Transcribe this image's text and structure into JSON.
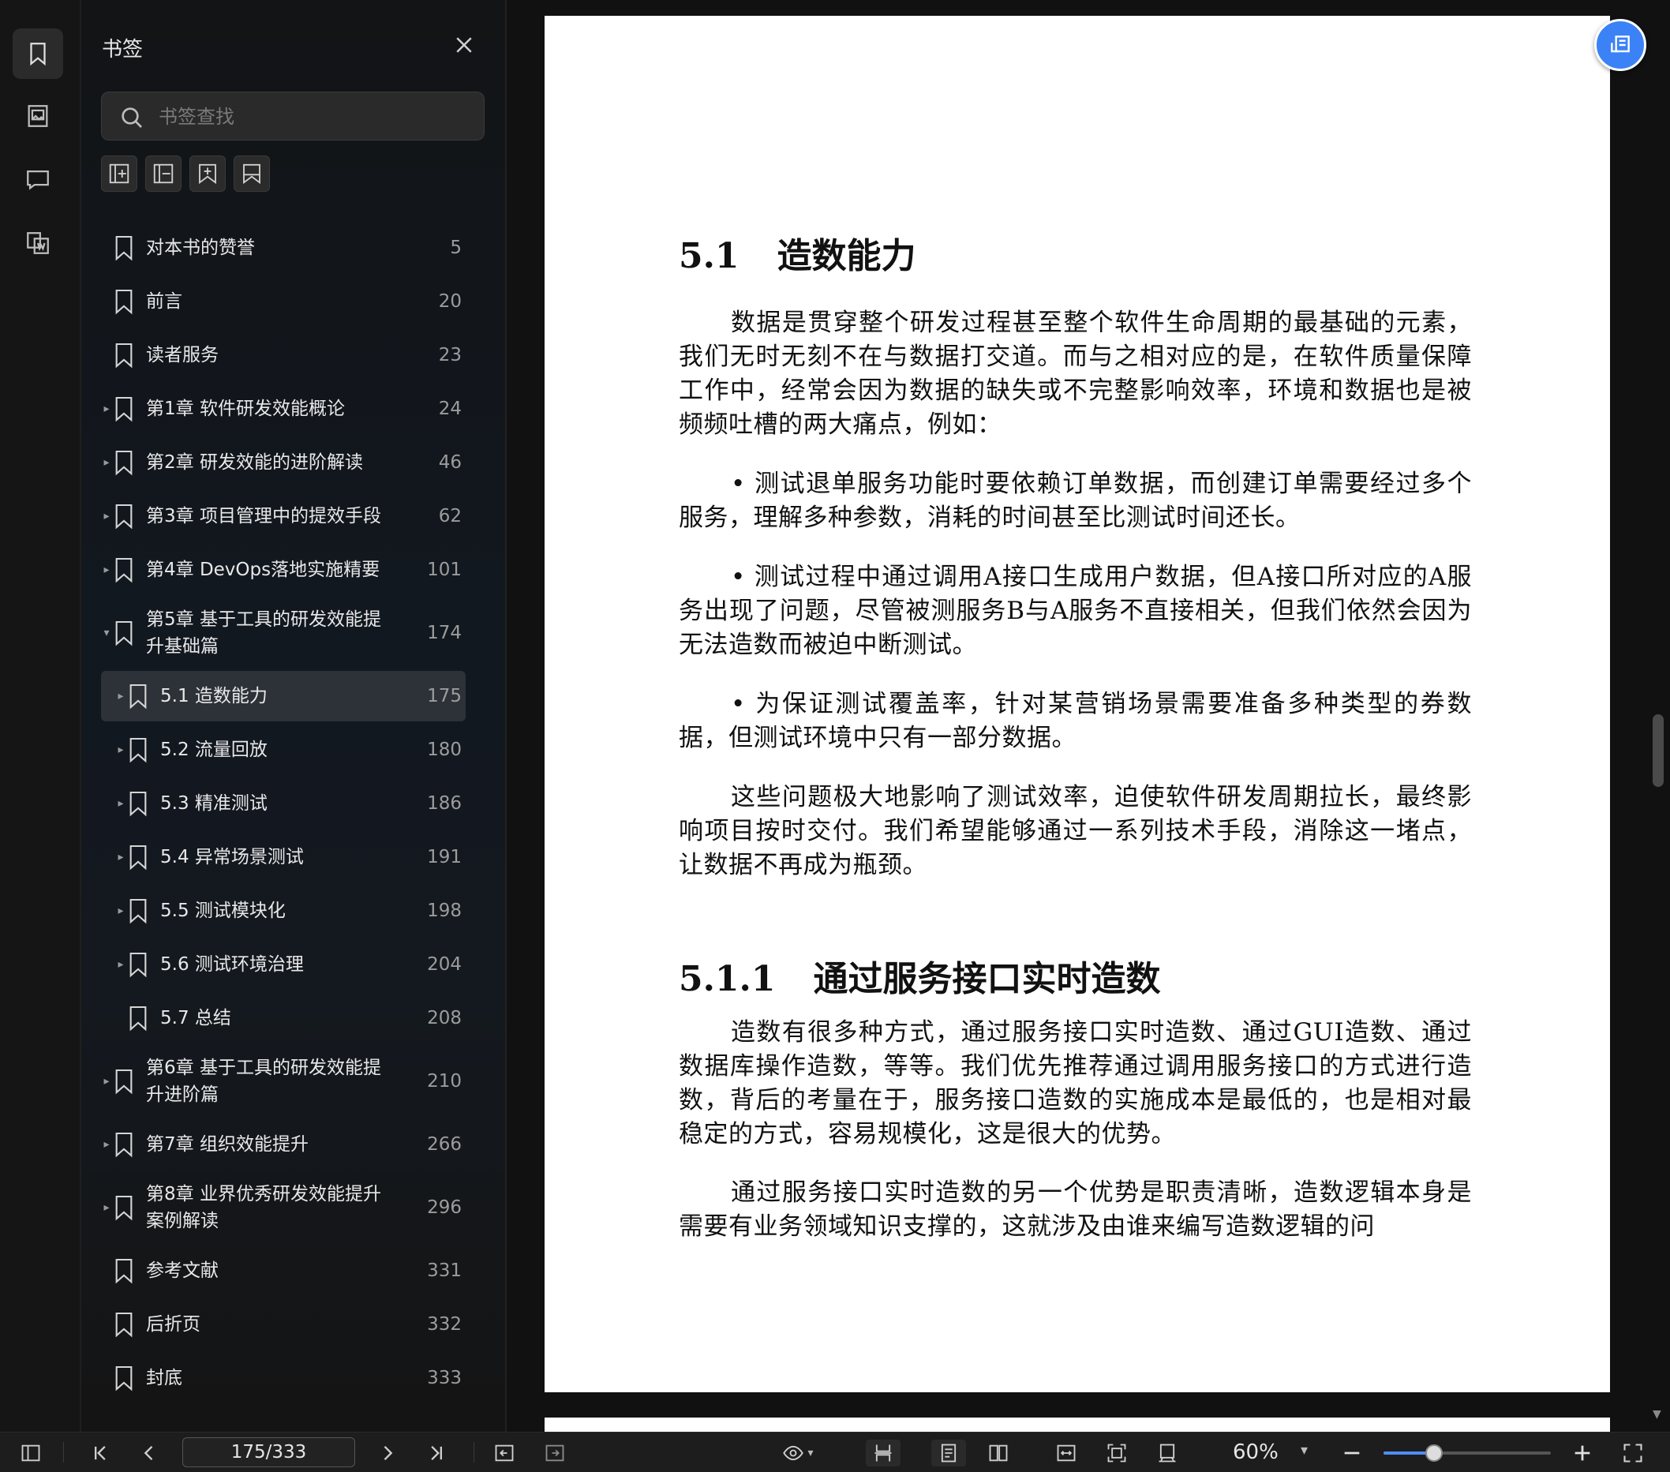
{
  "panel": {
    "title": "书签",
    "search_placeholder": "书签查找"
  },
  "bookmarks": [
    {
      "label": "对本书的赞誉",
      "page": "5",
      "arrow": "",
      "level": 0
    },
    {
      "label": "前言",
      "page": "20",
      "arrow": "",
      "level": 0
    },
    {
      "label": "读者服务",
      "page": "23",
      "arrow": "",
      "level": 0
    },
    {
      "label": "第1章 软件研发效能概论",
      "page": "24",
      "arrow": "▸",
      "level": 0
    },
    {
      "label": "第2章 研发效能的进阶解读",
      "page": "46",
      "arrow": "▸",
      "level": 0
    },
    {
      "label": "第3章 项目管理中的提效手段",
      "page": "62",
      "arrow": "▸",
      "level": 0
    },
    {
      "label": "第4章 DevOps落地实施精要",
      "page": "101",
      "arrow": "▸",
      "level": 0
    },
    {
      "label": "第5章 基于工具的研发效能提升基础篇",
      "page": "174",
      "arrow": "▾",
      "level": 0,
      "tall": true
    },
    {
      "label": "5.1 造数能力",
      "page": "175",
      "arrow": "▸",
      "level": 1,
      "selected": true
    },
    {
      "label": "5.2 流量回放",
      "page": "180",
      "arrow": "▸",
      "level": 1
    },
    {
      "label": "5.3 精准测试",
      "page": "186",
      "arrow": "▸",
      "level": 1
    },
    {
      "label": "5.4 异常场景测试",
      "page": "191",
      "arrow": "▸",
      "level": 1
    },
    {
      "label": "5.5 测试模块化",
      "page": "198",
      "arrow": "▸",
      "level": 1
    },
    {
      "label": "5.6 测试环境治理",
      "page": "204",
      "arrow": "▸",
      "level": 1
    },
    {
      "label": "5.7 总结",
      "page": "208",
      "arrow": "",
      "level": 1
    },
    {
      "label": "第6章 基于工具的研发效能提升进阶篇",
      "page": "210",
      "arrow": "▸",
      "level": 0,
      "tall": true
    },
    {
      "label": "第7章 组织效能提升",
      "page": "266",
      "arrow": "▸",
      "level": 0
    },
    {
      "label": "第8章 业界优秀研发效能提升案例解读",
      "page": "296",
      "arrow": "▸",
      "level": 0,
      "tall": true
    },
    {
      "label": "参考文献",
      "page": "331",
      "arrow": "",
      "level": 0
    },
    {
      "label": "后折页",
      "page": "332",
      "arrow": "",
      "level": 0
    },
    {
      "label": "封底",
      "page": "333",
      "arrow": "",
      "level": 0
    }
  ],
  "document": {
    "heading1_num": "5.1",
    "heading1_text": "造数能力",
    "p1": "数据是贯穿整个研发过程甚至整个软件生命周期的最基础的元素，我们无时无刻不在与数据打交道。而与之相对应的是，在软件质量保障工作中，经常会因为数据的缺失或不完整影响效率，环境和数据也是被频频吐槽的两大痛点，例如：",
    "p2": "• 测试退单服务功能时要依赖订单数据，而创建订单需要经过多个服务，理解多种参数，消耗的时间甚至比测试时间还长。",
    "p3": "• 测试过程中通过调用A接口生成用户数据，但A接口所对应的A服务出现了问题，尽管被测服务B与A服务不直接相关，但我们依然会因为无法造数而被迫中断测试。",
    "p4": "• 为保证测试覆盖率，针对某营销场景需要准备多种类型的券数据，但测试环境中只有一部分数据。",
    "p5": "这些问题极大地影响了测试效率，迫使软件研发周期拉长，最终影响项目按时交付。我们希望能够通过一系列技术手段，消除这一堵点，让数据不再成为瓶颈。",
    "heading2_num": "5.1.1",
    "heading2_text": "通过服务接口实时造数",
    "p6": "造数有很多种方式，通过服务接口实时造数、通过GUI造数、通过数据库操作造数，等等。我们优先推荐通过调用服务接口的方式进行造数，背后的考量在于，服务接口造数的实施成本是最低的，也是相对最稳定的方式，容易规模化，这是很大的优势。",
    "p7": "通过服务接口实时造数的另一个优势是职责清晰，造数逻辑本身是需要有业务领域知识支撑的，这就涉及由谁来编写造数逻辑的问"
  },
  "toolbar": {
    "page_indicator": "175/333",
    "zoom": "60%",
    "zoom_level_percent": 60
  },
  "icons": {
    "rail": [
      "bookmark-icon",
      "image-icon",
      "comment-icon",
      "convert-icon"
    ],
    "tools": [
      "expand-all-icon",
      "collapse-all-icon",
      "add-bookmark-icon",
      "bookmark-icon"
    ]
  }
}
